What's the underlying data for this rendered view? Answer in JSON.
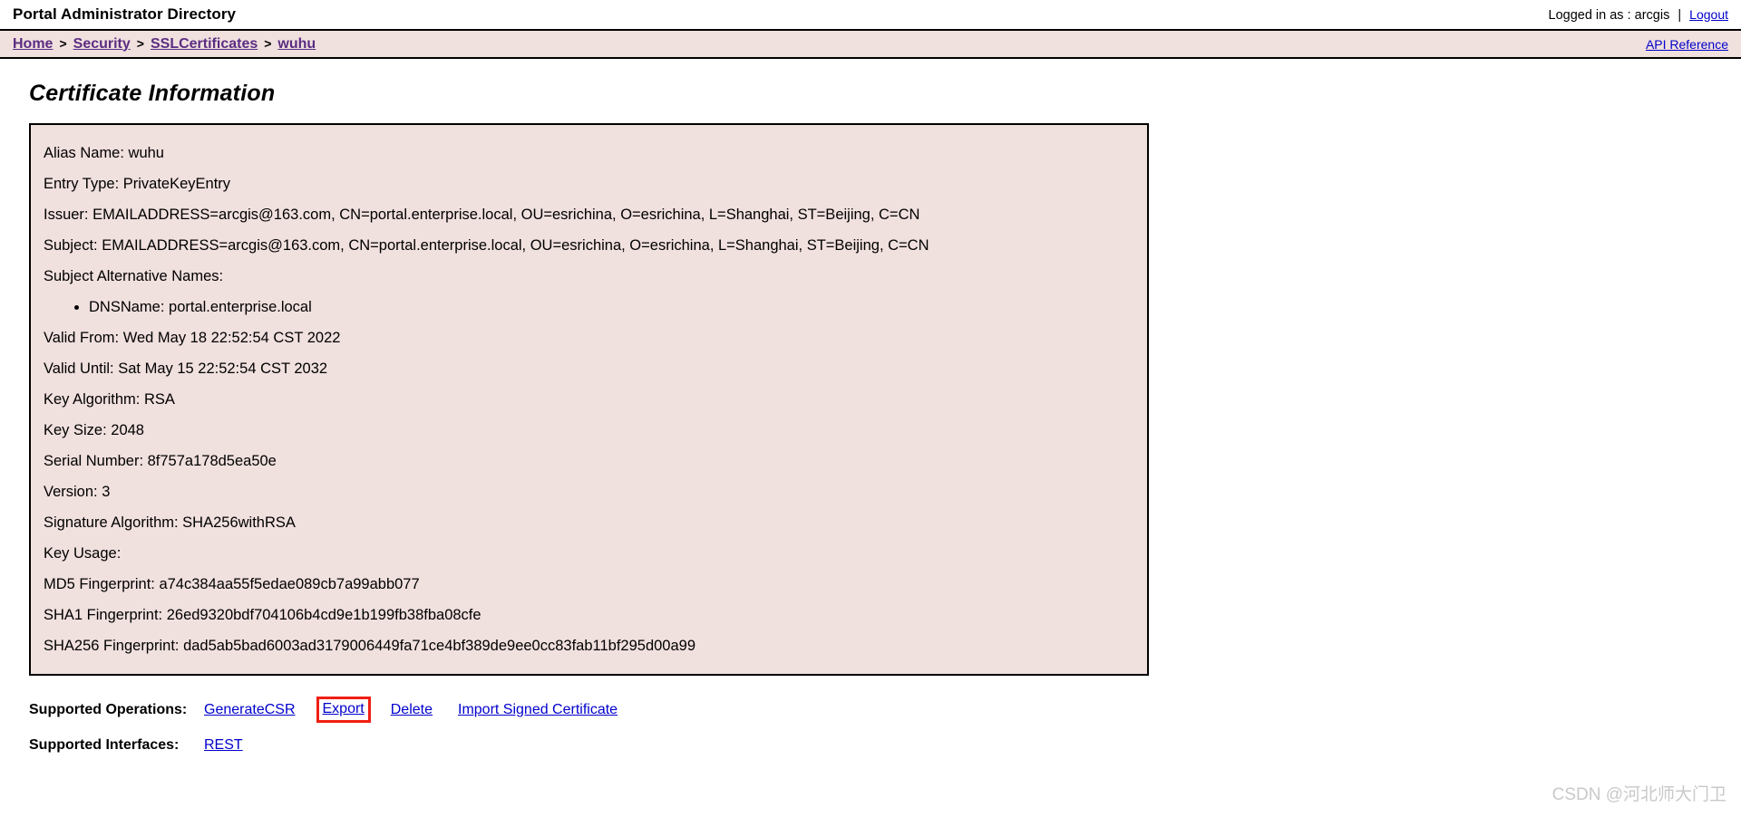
{
  "header": {
    "app_title": "Portal Administrator Directory",
    "logged_in_text": "Logged in as : arcgis",
    "separator": "|",
    "logout_label": "Logout"
  },
  "breadcrumb": {
    "items": [
      {
        "label": "Home"
      },
      {
        "label": "Security"
      },
      {
        "label": "SSLCertificates"
      },
      {
        "label": "wuhu"
      }
    ],
    "separator": ">",
    "api_reference_label": "API Reference"
  },
  "main": {
    "page_title": "Certificate Information",
    "certificate": {
      "alias_name": "Alias Name: wuhu",
      "entry_type": "Entry Type: PrivateKeyEntry",
      "issuer": "Issuer: EMAILADDRESS=arcgis@163.com, CN=portal.enterprise.local, OU=esrichina, O=esrichina, L=Shanghai, ST=Beijing, C=CN",
      "subject": "Subject: EMAILADDRESS=arcgis@163.com, CN=portal.enterprise.local, OU=esrichina, O=esrichina, L=Shanghai, ST=Beijing, C=CN",
      "san_heading": "Subject Alternative Names:",
      "san_items": [
        "DNSName: portal.enterprise.local"
      ],
      "valid_from": "Valid From: Wed May 18 22:52:54 CST 2022",
      "valid_until": "Valid Until: Sat May 15 22:52:54 CST 2032",
      "key_algorithm": "Key Algorithm: RSA",
      "key_size": "Key Size: 2048",
      "serial_number": "Serial Number: 8f757a178d5ea50e",
      "version": "Version: 3",
      "signature_algorithm": "Signature Algorithm: SHA256withRSA",
      "key_usage": "Key Usage:",
      "md5_fingerprint": "MD5 Fingerprint: a74c384aa55f5edae089cb7a99abb077",
      "sha1_fingerprint": "SHA1 Fingerprint: 26ed9320bdf704106b4cd9e1b199fb38fba08cfe",
      "sha256_fingerprint": "SHA256 Fingerprint: dad5ab5bad6003ad3179006449fa71ce4bf389de9ee0cc83fab11bf295d00a99"
    },
    "supported_operations": {
      "label": "Supported Operations:",
      "links": [
        {
          "label": "GenerateCSR",
          "highlighted": false
        },
        {
          "label": "Export",
          "highlighted": true
        },
        {
          "label": "Delete",
          "highlighted": false
        },
        {
          "label": "Import Signed Certificate",
          "highlighted": false
        }
      ]
    },
    "supported_interfaces": {
      "label": "Supported Interfaces:",
      "links": [
        {
          "label": "REST"
        }
      ]
    }
  },
  "watermark": {
    "text": "CSDN @河北师大门卫"
  },
  "colors": {
    "panel_background": "#f0e0de",
    "link": "#0000cc",
    "breadcrumb_link": "#5a2d82",
    "highlight_border": "#f01e12",
    "text": "#000000",
    "watermark": "#c9c9c9"
  }
}
